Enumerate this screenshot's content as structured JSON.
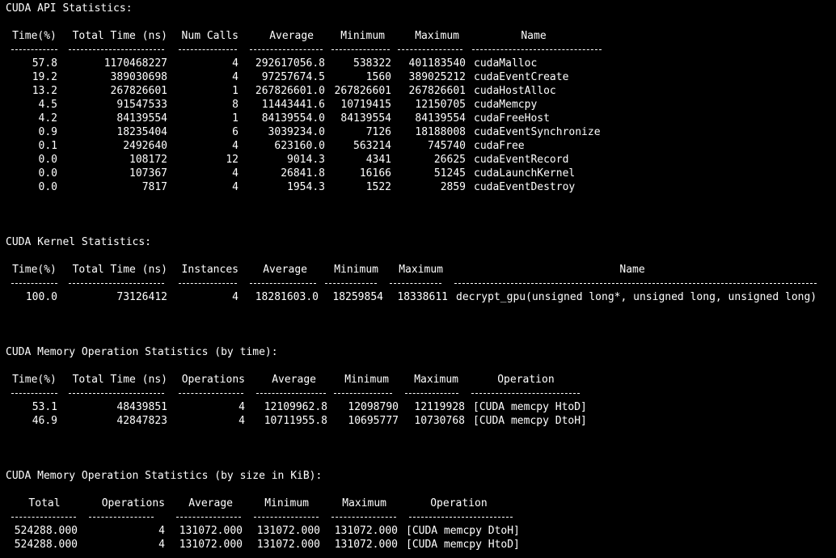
{
  "api": {
    "title": "CUDA API Statistics:",
    "headers": [
      "Time(%)",
      "Total Time (ns)",
      "Num Calls",
      "Average",
      "Minimum",
      "Maximum",
      "Name"
    ],
    "rows": [
      [
        "57.8",
        "1170468227",
        "4",
        "292617056.8",
        "538322",
        "401183540",
        "cudaMalloc"
      ],
      [
        "19.2",
        "389030698",
        "4",
        "97257674.5",
        "1560",
        "389025212",
        "cudaEventCreate"
      ],
      [
        "13.2",
        "267826601",
        "1",
        "267826601.0",
        "267826601",
        "267826601",
        "cudaHostAlloc"
      ],
      [
        "4.5",
        "91547533",
        "8",
        "11443441.6",
        "10719415",
        "12150705",
        "cudaMemcpy"
      ],
      [
        "4.2",
        "84139554",
        "1",
        "84139554.0",
        "84139554",
        "84139554",
        "cudaFreeHost"
      ],
      [
        "0.9",
        "18235404",
        "6",
        "3039234.0",
        "7126",
        "18188008",
        "cudaEventSynchronize"
      ],
      [
        "0.1",
        "2492640",
        "4",
        "623160.0",
        "563214",
        "745740",
        "cudaFree"
      ],
      [
        "0.0",
        "108172",
        "12",
        "9014.3",
        "4341",
        "26625",
        "cudaEventRecord"
      ],
      [
        "0.0",
        "107367",
        "4",
        "26841.8",
        "16166",
        "51245",
        "cudaLaunchKernel"
      ],
      [
        "0.0",
        "7817",
        "4",
        "1954.3",
        "1522",
        "2859",
        "cudaEventDestroy"
      ]
    ]
  },
  "kernel": {
    "title": "CUDA Kernel Statistics:",
    "headers": [
      "Time(%)",
      "Total Time (ns)",
      "Instances",
      "Average",
      "Minimum",
      "Maximum",
      "Name"
    ],
    "rows": [
      [
        "100.0",
        "73126412",
        "4",
        "18281603.0",
        "18259854",
        "18338611",
        "decrypt_gpu(unsigned long*, unsigned long, unsigned long)"
      ]
    ]
  },
  "memtime": {
    "title": "CUDA Memory Operation Statistics (by time):",
    "headers": [
      "Time(%)",
      "Total Time (ns)",
      "Operations",
      "Average",
      "Minimum",
      "Maximum",
      "Operation"
    ],
    "rows": [
      [
        "53.1",
        "48439851",
        "4",
        "12109962.8",
        "12098790",
        "12119928",
        "[CUDA memcpy HtoD]"
      ],
      [
        "46.9",
        "42847823",
        "4",
        "10711955.8",
        "10695777",
        "10730768",
        "[CUDA memcpy DtoH]"
      ]
    ]
  },
  "memsize": {
    "title": "CUDA Memory Operation Statistics (by size in KiB):",
    "headers": [
      "Total",
      "Operations",
      "Average",
      "Minimum",
      "Maximum",
      "Operation"
    ],
    "rows": [
      [
        "524288.000",
        "4",
        "131072.000",
        "131072.000",
        "131072.000",
        "[CUDA memcpy DtoH]"
      ],
      [
        "524288.000",
        "4",
        "131072.000",
        "131072.000",
        "131072.000",
        "[CUDA memcpy HtoD]"
      ]
    ]
  }
}
